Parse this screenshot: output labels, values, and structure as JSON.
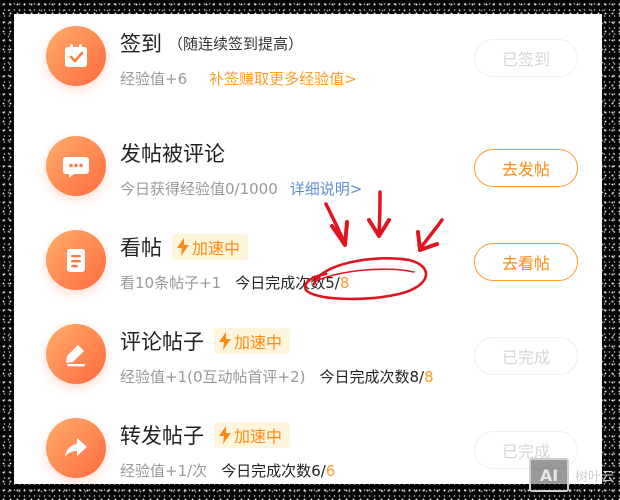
{
  "tasks": [
    {
      "title": "签到",
      "title_note": "（随连续签到提高）",
      "reward": "经验值+6",
      "link": "补签赚取更多经验值>",
      "button": "已签到",
      "icon": "calendar-check-icon"
    },
    {
      "title": "发帖被评论",
      "reward": "今日获得经验值0/1000",
      "link": "详细说明>",
      "button": "去发帖",
      "icon": "chat-bubble-icon"
    },
    {
      "title": "看帖",
      "badge": "加速中",
      "reward": "看10条帖子+1",
      "count_label": "今日完成次数",
      "count_done": "5/",
      "count_total": "8",
      "button": "去看帖",
      "icon": "document-icon"
    },
    {
      "title": "评论帖子",
      "badge": "加速中",
      "reward": "经验值+1(0互动帖首评+2)",
      "count_label": "今日完成次数",
      "count_done": "8/",
      "count_total": "8",
      "button": "已完成",
      "icon": "pen-icon"
    },
    {
      "title": "转发帖子",
      "badge": "加速中",
      "reward": "经验值+1/次",
      "count_label": "今日完成次数",
      "count_done": "6/",
      "count_total": "6",
      "button": "已完成",
      "icon": "share-arrow-icon"
    }
  ],
  "watermark": {
    "logo": "AI",
    "text": "树叶云"
  },
  "colors": {
    "accent": "#ff8a14",
    "badge_bg": "#fff4dc",
    "link_blue": "#5a8fd6",
    "annotation_red": "#e0141e"
  }
}
